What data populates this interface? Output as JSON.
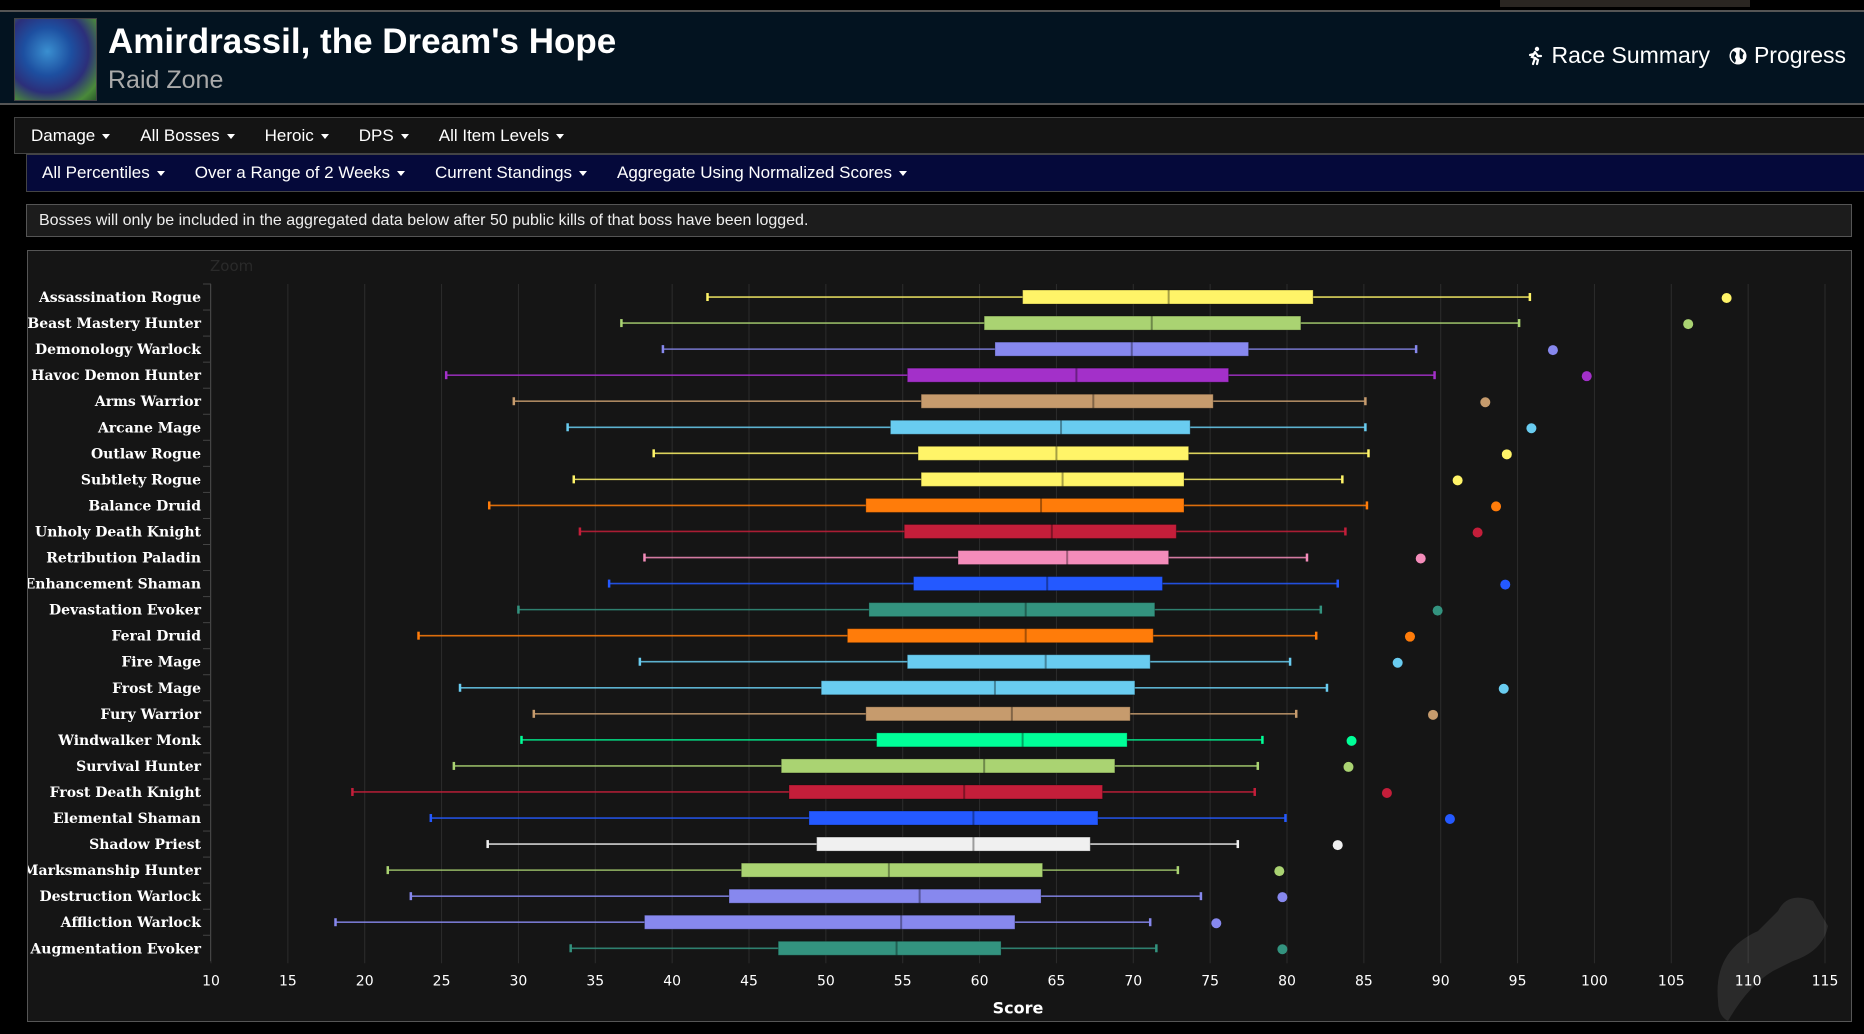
{
  "header": {
    "title": "Amirdrassil, the Dream's Hope",
    "subtitle": "Raid Zone",
    "links": [
      {
        "label": "Race Summary",
        "icon": "running-person-icon"
      },
      {
        "label": "Progress",
        "icon": "globe-icon"
      }
    ]
  },
  "filters_primary": [
    {
      "label": "Damage"
    },
    {
      "label": "All Bosses"
    },
    {
      "label": "Heroic"
    },
    {
      "label": "DPS"
    },
    {
      "label": "All Item Levels"
    }
  ],
  "filters_secondary": [
    {
      "label": "All Percentiles"
    },
    {
      "label": "Over a Range of 2 Weeks"
    },
    {
      "label": "Current Standings"
    },
    {
      "label": "Aggregate Using Normalized Scores"
    }
  ],
  "notice": "Bosses will only be included in the aggregated data below after 50 public kills of that boss have been logged.",
  "chart_data": {
    "type": "boxplot",
    "orientation": "horizontal",
    "zoom_label": "Zoom",
    "xlabel": "Score",
    "xlim": [
      10,
      115
    ],
    "xticks": [
      10,
      15,
      20,
      25,
      30,
      35,
      40,
      45,
      50,
      55,
      60,
      65,
      70,
      75,
      80,
      85,
      90,
      95,
      100,
      105,
      110,
      115
    ],
    "grid": "vertical",
    "categories": [
      "Assassination Rogue",
      "Beast Mastery Hunter",
      "Demonology Warlock",
      "Havoc Demon Hunter",
      "Arms Warrior",
      "Arcane Mage",
      "Outlaw Rogue",
      "Subtlety Rogue",
      "Balance Druid",
      "Unholy Death Knight",
      "Retribution Paladin",
      "Enhancement Shaman",
      "Devastation Evoker",
      "Feral Druid",
      "Fire Mage",
      "Frost Mage",
      "Fury Warrior",
      "Windwalker Monk",
      "Survival Hunter",
      "Frost Death Knight",
      "Elemental Shaman",
      "Shadow Priest",
      "Marksmanship Hunter",
      "Destruction Warlock",
      "Affliction Warlock",
      "Augmentation Evoker"
    ],
    "series": [
      {
        "name": "Assassination Rogue",
        "color": "#fff468",
        "min": 42.3,
        "q1": 62.8,
        "median": 72.3,
        "q3": 81.7,
        "max": 95.8,
        "outlier": 108.6
      },
      {
        "name": "Beast Mastery Hunter",
        "color": "#aad372",
        "min": 36.7,
        "q1": 60.3,
        "median": 71.2,
        "q3": 80.9,
        "max": 95.1,
        "outlier": 106.1
      },
      {
        "name": "Demonology Warlock",
        "color": "#8788ee",
        "min": 39.4,
        "q1": 61.0,
        "median": 69.9,
        "q3": 77.5,
        "max": 88.4,
        "outlier": 97.3
      },
      {
        "name": "Havoc Demon Hunter",
        "color": "#a330c9",
        "min": 25.3,
        "q1": 55.3,
        "median": 66.3,
        "q3": 76.2,
        "max": 89.6,
        "outlier": 99.5
      },
      {
        "name": "Arms Warrior",
        "color": "#c69b6d",
        "min": 29.7,
        "q1": 56.2,
        "median": 67.4,
        "q3": 75.2,
        "max": 85.1,
        "outlier": 92.9
      },
      {
        "name": "Arcane Mage",
        "color": "#69ccf0",
        "min": 33.2,
        "q1": 54.2,
        "median": 65.3,
        "q3": 73.7,
        "max": 85.1,
        "outlier": 95.9
      },
      {
        "name": "Outlaw Rogue",
        "color": "#fff468",
        "min": 38.8,
        "q1": 56.0,
        "median": 65.0,
        "q3": 73.6,
        "max": 85.3,
        "outlier": 94.3
      },
      {
        "name": "Subtlety Rogue",
        "color": "#fff468",
        "min": 33.6,
        "q1": 56.2,
        "median": 65.4,
        "q3": 73.3,
        "max": 83.6,
        "outlier": 91.1
      },
      {
        "name": "Balance Druid",
        "color": "#ff7c0a",
        "min": 28.1,
        "q1": 52.6,
        "median": 64.0,
        "q3": 73.3,
        "max": 85.2,
        "outlier": 93.6
      },
      {
        "name": "Unholy Death Knight",
        "color": "#c41e3a",
        "min": 34.0,
        "q1": 55.1,
        "median": 64.7,
        "q3": 72.8,
        "max": 83.8,
        "outlier": 92.4
      },
      {
        "name": "Retribution Paladin",
        "color": "#f48cba",
        "min": 38.2,
        "q1": 58.6,
        "median": 65.7,
        "q3": 72.3,
        "max": 81.3,
        "outlier": 88.7
      },
      {
        "name": "Enhancement Shaman",
        "color": "#2459ff",
        "min": 35.9,
        "q1": 55.7,
        "median": 64.4,
        "q3": 71.9,
        "max": 83.3,
        "outlier": 94.2
      },
      {
        "name": "Devastation Evoker",
        "color": "#33937f",
        "min": 30.0,
        "q1": 52.8,
        "median": 63.0,
        "q3": 71.4,
        "max": 82.2,
        "outlier": 89.8
      },
      {
        "name": "Feral Druid",
        "color": "#ff7c0a",
        "min": 23.5,
        "q1": 51.4,
        "median": 63.0,
        "q3": 71.3,
        "max": 81.9,
        "outlier": 88.0
      },
      {
        "name": "Fire Mage",
        "color": "#69ccf0",
        "min": 37.9,
        "q1": 55.3,
        "median": 64.3,
        "q3": 71.1,
        "max": 80.2,
        "outlier": 87.2
      },
      {
        "name": "Frost Mage",
        "color": "#69ccf0",
        "min": 26.2,
        "q1": 49.7,
        "median": 61.0,
        "q3": 70.1,
        "max": 82.6,
        "outlier": 94.1
      },
      {
        "name": "Fury Warrior",
        "color": "#c69b6d",
        "min": 31.0,
        "q1": 52.6,
        "median": 62.1,
        "q3": 69.8,
        "max": 80.6,
        "outlier": 89.5
      },
      {
        "name": "Windwalker Monk",
        "color": "#00ff98",
        "min": 30.2,
        "q1": 53.3,
        "median": 62.8,
        "q3": 69.6,
        "max": 78.4,
        "outlier": 84.2
      },
      {
        "name": "Survival Hunter",
        "color": "#aad372",
        "min": 25.8,
        "q1": 47.1,
        "median": 60.3,
        "q3": 68.8,
        "max": 78.1,
        "outlier": 84.0
      },
      {
        "name": "Frost Death Knight",
        "color": "#c41e3a",
        "min": 19.2,
        "q1": 47.6,
        "median": 59.0,
        "q3": 68.0,
        "max": 77.9,
        "outlier": 86.5
      },
      {
        "name": "Elemental Shaman",
        "color": "#2459ff",
        "min": 24.3,
        "q1": 48.9,
        "median": 59.6,
        "q3": 67.7,
        "max": 79.9,
        "outlier": 90.6
      },
      {
        "name": "Shadow Priest",
        "color": "#f0f0f0",
        "min": 28.0,
        "q1": 49.4,
        "median": 59.6,
        "q3": 67.2,
        "max": 76.8,
        "outlier": 83.3
      },
      {
        "name": "Marksmanship Hunter",
        "color": "#aad372",
        "min": 21.5,
        "q1": 44.5,
        "median": 54.1,
        "q3": 64.1,
        "max": 72.9,
        "outlier": 79.5
      },
      {
        "name": "Destruction Warlock",
        "color": "#8788ee",
        "min": 23.0,
        "q1": 43.7,
        "median": 56.1,
        "q3": 64.0,
        "max": 74.4,
        "outlier": 79.7
      },
      {
        "name": "Affliction Warlock",
        "color": "#8788ee",
        "min": 18.1,
        "q1": 38.2,
        "median": 54.9,
        "q3": 62.3,
        "max": 71.1,
        "outlier": 75.4
      },
      {
        "name": "Augmentation Evoker",
        "color": "#33937f",
        "min": 33.4,
        "q1": 46.9,
        "median": 54.6,
        "q3": 61.4,
        "max": 71.5,
        "outlier": 79.7
      }
    ]
  }
}
